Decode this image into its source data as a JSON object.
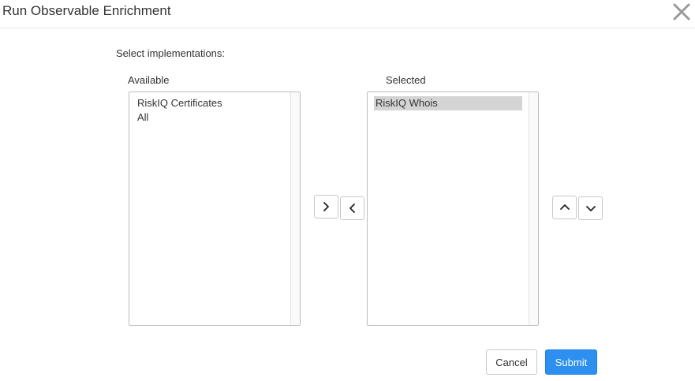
{
  "dialog": {
    "title": "Run Observable Enrichment",
    "close_icon": "close-icon"
  },
  "form": {
    "section_label": "Select implementations:",
    "available": {
      "label": "Available",
      "items": [
        "RiskIQ Certificates",
        "All"
      ]
    },
    "selected": {
      "label": "Selected",
      "items": [
        "RiskIQ Whois"
      ],
      "highlighted_item": "RiskIQ Whois"
    },
    "transfer_buttons": {
      "move_right_icon": "chevron-right-icon",
      "move_left_icon": "chevron-left-icon"
    },
    "order_buttons": {
      "move_up_icon": "chevron-up-icon",
      "move_down_icon": "chevron-down-icon"
    }
  },
  "footer": {
    "cancel_label": "Cancel",
    "submit_label": "Submit"
  },
  "colors": {
    "primary": "#2d8ff0",
    "selected_item_bg": "#d4d4d4",
    "border": "#bcbcbc"
  }
}
